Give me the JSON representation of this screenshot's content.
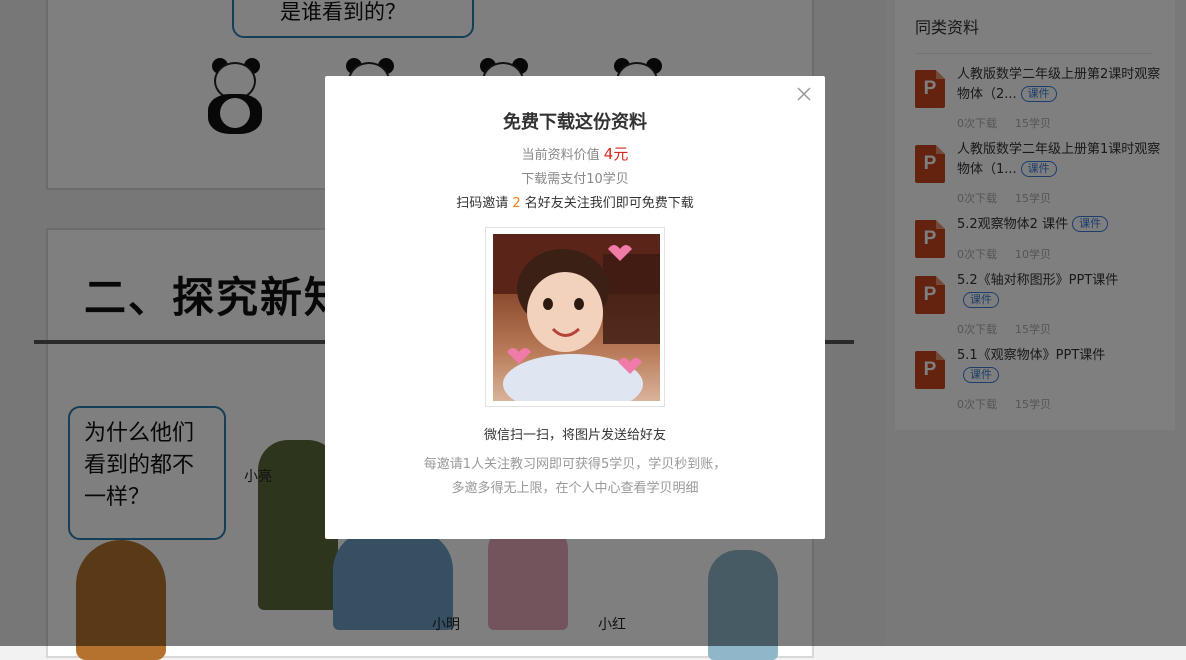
{
  "background_slides": {
    "slide1_bubble_line": "是谁看到的？",
    "slide2_title": "二、探究新知",
    "slide2_bubble_lines": [
      "为什么他们",
      "看到的都不",
      "一样？"
    ],
    "kid_labels": [
      "小亮",
      "小明",
      "小红"
    ]
  },
  "sidebar": {
    "title": "同类资料",
    "icon": "ppt-file-icon",
    "icon_letter": "P",
    "items": [
      {
        "title": "人教版数学二年级上册第2课时观察物体（2...",
        "tag": "课件",
        "downloads": "0次下载",
        "cost": "15学贝"
      },
      {
        "title": "人教版数学二年级上册第1课时观察物体（1...",
        "tag": "课件",
        "downloads": "0次下载",
        "cost": "15学贝"
      },
      {
        "title": "5.2观察物体2 课件",
        "tag": "课件",
        "downloads": "0次下载",
        "cost": "10学贝"
      },
      {
        "title": "5.2《轴对称图形》PPT课件",
        "tag": "课件",
        "downloads": "0次下载",
        "cost": "15学贝"
      },
      {
        "title": "5.1《观察物体》PPT课件",
        "tag": "课件",
        "downloads": "0次下载",
        "cost": "15学贝"
      }
    ]
  },
  "modal": {
    "title": "免费下载这份资料",
    "value_prefix": "当前资料价值",
    "value_price": "4元",
    "pay_text": "下载需支付10学贝",
    "invite_prefix": "扫码邀请",
    "invite_count": "2",
    "invite_suffix": "名好友关注我们即可免费下载",
    "scan_text": "微信扫一扫，将图片发送给好友",
    "note_text": "每邀请1人关注教习网即可获得5学贝，学贝秒到账，多邀多得无上限，在个人中心查看学贝明细",
    "close_icon": "close-icon"
  },
  "colors": {
    "price": "#d8281c",
    "invite_count": "#f27b1d",
    "tag": "#3a7bd5",
    "ppt_icon": "#c6461f",
    "overlay": "rgba(0,0,0,0.5)"
  }
}
